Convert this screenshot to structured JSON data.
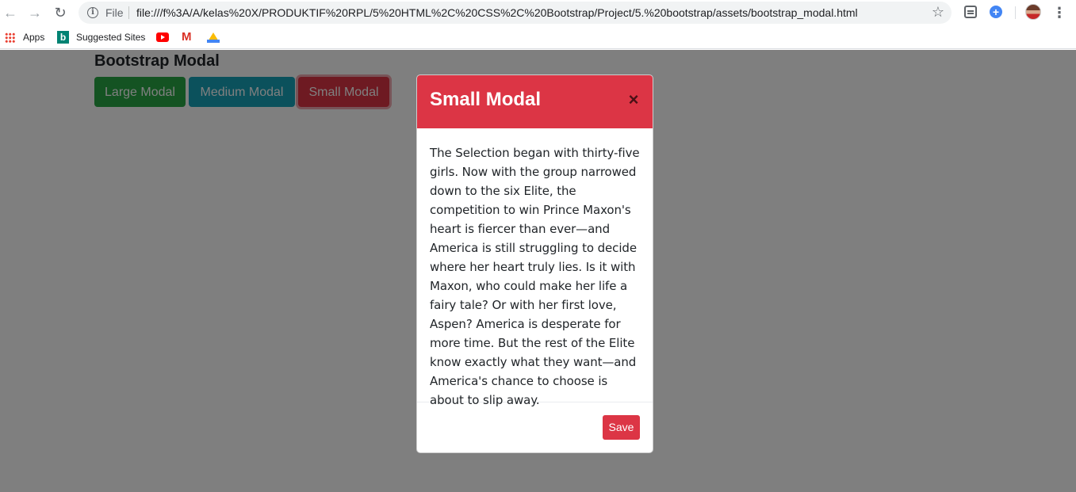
{
  "browser": {
    "scheme_label": "File",
    "url": "file:///f%3A/A/kelas%20X/PRODUKTIF%20RPL/5%20HTML%2C%20CSS%2C%20Bootstrap/Project/5.%20bootstrap/assets/bootstrap_modal.html",
    "bookmarks": {
      "apps": "Apps",
      "suggested": "Suggested Sites"
    }
  },
  "page": {
    "title": "Bootstrap Modal",
    "buttons": {
      "large": "Large Modal",
      "medium": "Medium Modal",
      "small": "Small Modal"
    }
  },
  "modal": {
    "title": "Small Modal",
    "close_glyph": "×",
    "body": "The Selection began with thirty-five girls. Now with the group narrowed down to the six Elite, the competition to win Prince Maxon's heart is fiercer than ever—and America is still struggling to decide where her heart truly lies. Is it with Maxon, who could make her life a fairy tale? Or with her first love, Aspen? America is desperate for more time. But the rest of the Elite know exactly what they want—and America's chance to choose is about to slip away.",
    "save_label": "Save"
  },
  "colors": {
    "danger": "#dc3545",
    "success": "#28a745",
    "info": "#17a2b8"
  },
  "icons": [
    "back-arrow-icon",
    "forward-arrow-icon",
    "reload-icon",
    "info-icon",
    "star-icon",
    "apps-grid-icon",
    "bing-icon",
    "youtube-icon",
    "gmail-icon",
    "drive-icon",
    "close-icon"
  ]
}
